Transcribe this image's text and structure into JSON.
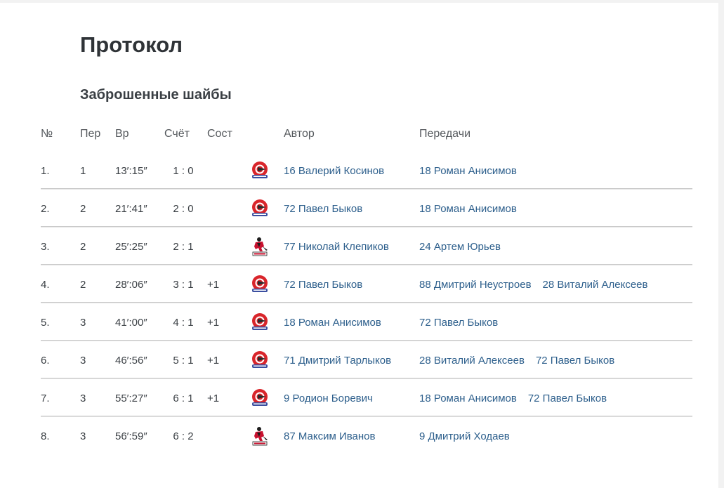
{
  "title": "Протокол",
  "section_title": "Заброшенные шайбы",
  "columns": {
    "num": "№",
    "period": "Пер",
    "time": "Вр",
    "score": "Счёт",
    "state": "Сост",
    "author": "Автор",
    "assists": "Передачи"
  },
  "colors": {
    "link": "#2d5f8c",
    "team_a_red": "#d9252b",
    "team_a_blue": "#3b4fa0",
    "team_b_red": "#c8102e",
    "divider": "#c9c9c9"
  },
  "goals": [
    {
      "num": "1.",
      "period": "1",
      "time": "13′:15″",
      "score": "1 : 0",
      "state": "",
      "team_icon": "team-a-logo",
      "author": "16 Валерий Косинов",
      "assists": [
        "18 Роман Анисимов"
      ]
    },
    {
      "num": "2.",
      "period": "2",
      "time": "21′:41″",
      "score": "2 : 0",
      "state": "",
      "team_icon": "team-a-logo",
      "author": "72 Павел Быков",
      "assists": [
        "18 Роман Анисимов"
      ]
    },
    {
      "num": "3.",
      "period": "2",
      "time": "25′:25″",
      "score": "2 : 1",
      "state": "",
      "team_icon": "team-b-logo",
      "author": "77 Николай Клепиков",
      "assists": [
        "24 Артем Юрьев"
      ]
    },
    {
      "num": "4.",
      "period": "2",
      "time": "28′:06″",
      "score": "3 : 1",
      "state": "+1",
      "team_icon": "team-a-logo",
      "author": "72 Павел Быков",
      "assists": [
        "88 Дмитрий Неустроев",
        "28 Виталий Алексеев"
      ]
    },
    {
      "num": "5.",
      "period": "3",
      "time": "41′:00″",
      "score": "4 : 1",
      "state": "+1",
      "team_icon": "team-a-logo",
      "author": "18 Роман Анисимов",
      "assists": [
        "72 Павел Быков"
      ]
    },
    {
      "num": "6.",
      "period": "3",
      "time": "46′:56″",
      "score": "5 : 1",
      "state": "+1",
      "team_icon": "team-a-logo",
      "author": "71 Дмитрий Тарлыков",
      "assists": [
        "28 Виталий Алексеев",
        "72 Павел Быков"
      ]
    },
    {
      "num": "7.",
      "period": "3",
      "time": "55′:27″",
      "score": "6 : 1",
      "state": "+1",
      "team_icon": "team-a-logo",
      "author": "9 Родион Боревич",
      "assists": [
        "18 Роман Анисимов",
        "72 Павел Быков"
      ]
    },
    {
      "num": "8.",
      "period": "3",
      "time": "56′:59″",
      "score": "6 : 2",
      "state": "",
      "team_icon": "team-b-logo",
      "author": "87 Максим Иванов",
      "assists": [
        "9 Дмитрий Ходаев"
      ]
    }
  ]
}
